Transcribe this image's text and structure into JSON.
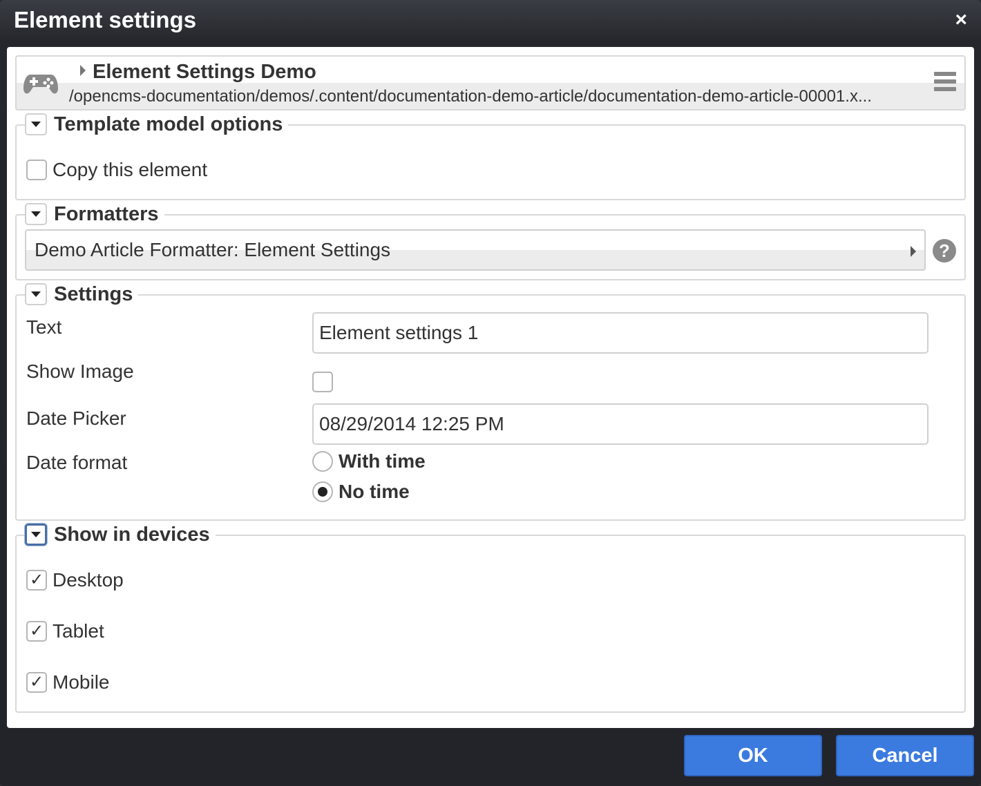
{
  "window": {
    "title": "Element settings",
    "close_label": "×"
  },
  "resource": {
    "icon": "gamepad-icon",
    "title": "Element Settings Demo",
    "path": "/opencms-documentation/demos/.content/documentation-demo-article/documentation-demo-article-00001.x..."
  },
  "template_model": {
    "legend": "Template model options",
    "copy_label": "Copy this element",
    "copy_checked": false
  },
  "formatters": {
    "legend": "Formatters",
    "selected": "Demo Article Formatter: Element Settings",
    "help": "?"
  },
  "settings": {
    "legend": "Settings",
    "text_label": "Text",
    "text_value": "Element settings 1",
    "show_image_label": "Show Image",
    "show_image_checked": false,
    "date_picker_label": "Date Picker",
    "date_picker_value": "08/29/2014 12:25 PM",
    "date_format_label": "Date format",
    "date_format_options": [
      {
        "label": "With time",
        "selected": false
      },
      {
        "label": "No time",
        "selected": true
      }
    ]
  },
  "devices": {
    "legend": "Show in devices",
    "items": [
      {
        "label": "Desktop",
        "checked": true
      },
      {
        "label": "Tablet",
        "checked": true
      },
      {
        "label": "Mobile",
        "checked": true
      }
    ],
    "check_mark": "✓"
  },
  "buttons": {
    "ok": "OK",
    "cancel": "Cancel"
  },
  "colors": {
    "primary_button": "#3b7be0",
    "title_bar": "#2b2d33"
  }
}
